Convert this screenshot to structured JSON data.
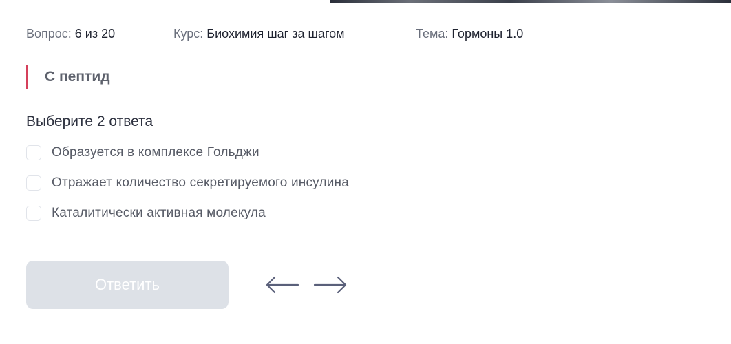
{
  "meta": {
    "question_key": "Вопрос:",
    "question_value": "6 из 20",
    "course_key": "Курс:",
    "course_value": "Биохимия шаг за шагом",
    "topic_key": "Тема:",
    "topic_value": "Гормоны 1.0"
  },
  "question": {
    "text": "С пептид",
    "accent_color": "#d5405b"
  },
  "instruction": "Выберите 2 ответа",
  "options": [
    {
      "label": "Образуется в комплексе Гольджи",
      "checked": false
    },
    {
      "label": "Отражает количество секретируемого инсулина",
      "checked": false
    },
    {
      "label": "Каталитически активная молекула",
      "checked": false
    }
  ],
  "actions": {
    "answer_label": "Ответить",
    "answer_disabled": true,
    "prev_icon": "arrow-left-icon",
    "next_icon": "arrow-right-icon"
  },
  "colors": {
    "button_disabled_bg": "#dde1e7",
    "arrow_color": "#5a607a"
  }
}
